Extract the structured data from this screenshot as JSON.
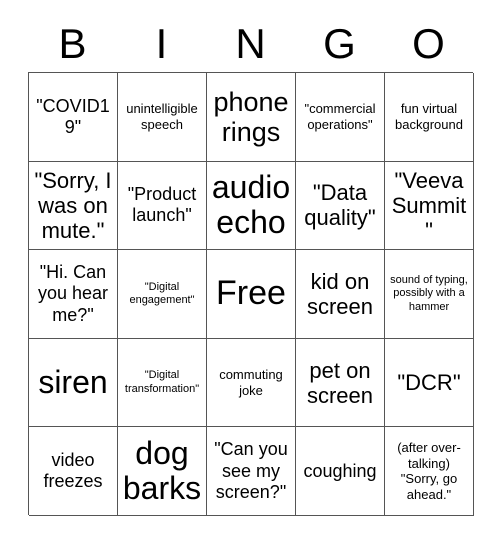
{
  "card": {
    "header_letters": [
      "B",
      "I",
      "N",
      "G",
      "O"
    ],
    "rows": [
      [
        {
          "text": "\"COVID19\"",
          "size": "md"
        },
        {
          "text": "unintelligible speech",
          "size": "sm"
        },
        {
          "text": "phone rings",
          "size": "xl"
        },
        {
          "text": "\"commercial operations\"",
          "size": "sm"
        },
        {
          "text": "fun virtual background",
          "size": "sm"
        }
      ],
      [
        {
          "text": "\"Sorry, I was on mute.\"",
          "size": "lg"
        },
        {
          "text": "\"Product launch\"",
          "size": "md"
        },
        {
          "text": "audio echo",
          "size": "xxl"
        },
        {
          "text": "\"Data quality\"",
          "size": "lg"
        },
        {
          "text": "\"Veeva Summit\"",
          "size": "lg"
        }
      ],
      [
        {
          "text": "\"Hi. Can you hear me?\"",
          "size": "md"
        },
        {
          "text": "\"Digital engagement\"",
          "size": "xs"
        },
        {
          "text": "Free",
          "size": "free"
        },
        {
          "text": "kid on screen",
          "size": "lg"
        },
        {
          "text": "sound of typing, possibly with a hammer",
          "size": "xs"
        }
      ],
      [
        {
          "text": "siren",
          "size": "xxl"
        },
        {
          "text": "\"Digital transformation\"",
          "size": "xs"
        },
        {
          "text": "commuting joke",
          "size": "sm"
        },
        {
          "text": "pet on screen",
          "size": "lg"
        },
        {
          "text": "\"DCR\"",
          "size": "lg"
        }
      ],
      [
        {
          "text": "video freezes",
          "size": "md"
        },
        {
          "text": "dog barks",
          "size": "xxl"
        },
        {
          "text": "\"Can you see my screen?\"",
          "size": "md"
        },
        {
          "text": "coughing",
          "size": "md"
        },
        {
          "text": "(after over-talking) \"Sorry, go ahead.\"",
          "size": "sm"
        }
      ]
    ]
  },
  "colors": {
    "background": "#ffffff",
    "text": "#000000",
    "grid_line": "#555555"
  }
}
